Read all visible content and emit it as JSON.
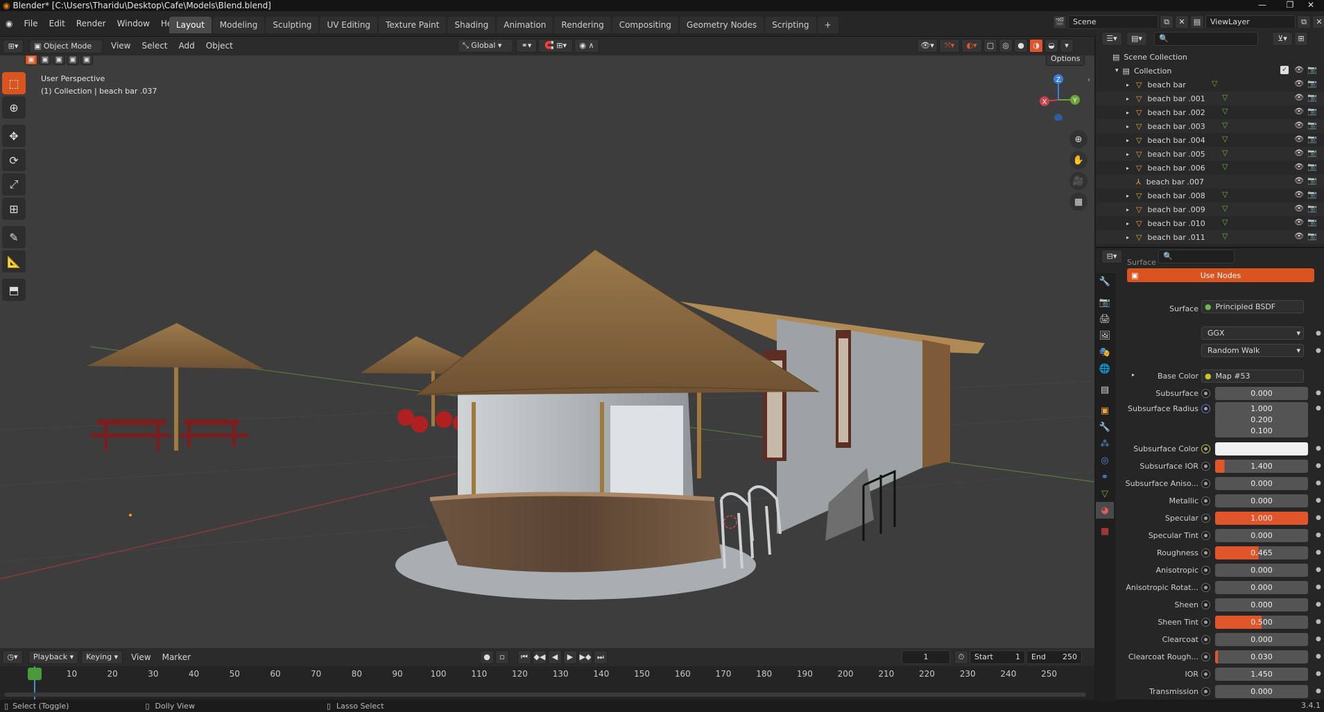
{
  "title_bar": {
    "title": "Blender* [C:\\Users\\Tharidu\\Desktop\\Cafe\\Models\\Blend.blend]"
  },
  "top_menu": [
    "File",
    "Edit",
    "Render",
    "Window",
    "Help"
  ],
  "workspace_tabs": [
    "Layout",
    "Modeling",
    "Sculpting",
    "UV Editing",
    "Texture Paint",
    "Shading",
    "Animation",
    "Rendering",
    "Compositing",
    "Geometry Nodes",
    "Scripting"
  ],
  "active_workspace": "Layout",
  "scene": {
    "scene_name": "Scene",
    "view_layer": "ViewLayer"
  },
  "viewport_header": {
    "mode": "Object Mode",
    "menus": [
      "View",
      "Select",
      "Add",
      "Object"
    ],
    "orientation": "Global",
    "options_label": "Options"
  },
  "viewport": {
    "info_line1": "User Perspective",
    "info_line2": "(1) Collection | beach bar .037"
  },
  "gizmo": {
    "z": "Z",
    "y": "Y",
    "x": "X"
  },
  "timeline": {
    "menus": [
      "Playback",
      "Keying",
      "View",
      "Marker"
    ],
    "current_frame": "1",
    "start_label": "Start",
    "start": "1",
    "end_label": "End",
    "end": "250",
    "ticks": [
      "1",
      "10",
      "20",
      "30",
      "40",
      "50",
      "60",
      "70",
      "80",
      "90",
      "100",
      "110",
      "120",
      "130",
      "140",
      "150",
      "160",
      "170",
      "180",
      "190",
      "200",
      "210",
      "220",
      "230",
      "240",
      "250"
    ]
  },
  "status_bar": {
    "left": "Select (Toggle)",
    "middle": "Dolly View",
    "right": "Lasso Select",
    "version": "3.4.1"
  },
  "outliner": {
    "root": "Scene Collection",
    "collection": "Collection",
    "items": [
      {
        "name": "beach bar",
        "type": "mesh"
      },
      {
        "name": "beach bar .001",
        "type": "mesh"
      },
      {
        "name": "beach bar .002",
        "type": "mesh"
      },
      {
        "name": "beach bar .003",
        "type": "mesh"
      },
      {
        "name": "beach bar .004",
        "type": "mesh"
      },
      {
        "name": "beach bar .005",
        "type": "mesh"
      },
      {
        "name": "beach bar .006",
        "type": "mesh"
      },
      {
        "name": "beach bar .007",
        "type": "empty"
      },
      {
        "name": "beach bar .008",
        "type": "mesh"
      },
      {
        "name": "beach bar .009",
        "type": "mesh"
      },
      {
        "name": "beach bar .010",
        "type": "mesh"
      },
      {
        "name": "beach bar .011",
        "type": "mesh"
      }
    ]
  },
  "properties": {
    "section": "Surface",
    "use_nodes": "Use Nodes",
    "surface_label": "Surface",
    "surface_value": "Principled BSDF",
    "distribution": "GGX",
    "subsurface_method": "Random Walk",
    "fields": [
      {
        "label": "Base Color",
        "value": "Map #53",
        "kind": "link"
      },
      {
        "label": "Subsurface",
        "value": "0.000",
        "kind": "num",
        "fill": 0
      },
      {
        "label": "Subsurface Radius",
        "value": "1.000",
        "kind": "vec"
      },
      {
        "label": "",
        "value": "0.200",
        "kind": "vec"
      },
      {
        "label": "",
        "value": "0.100",
        "kind": "vec"
      },
      {
        "label": "Subsurface Color",
        "value": "",
        "kind": "color"
      },
      {
        "label": "Subsurface IOR",
        "value": "1.400",
        "kind": "num",
        "fill": 0.1
      },
      {
        "label": "Subsurface Aniso...",
        "value": "0.000",
        "kind": "num",
        "fill": 0
      },
      {
        "label": "Metallic",
        "value": "0.000",
        "kind": "num",
        "fill": 0
      },
      {
        "label": "Specular",
        "value": "1.000",
        "kind": "num",
        "fill": 1
      },
      {
        "label": "Specular Tint",
        "value": "0.000",
        "kind": "num",
        "fill": 0
      },
      {
        "label": "Roughness",
        "value": "0.465",
        "kind": "num",
        "fill": 0.465
      },
      {
        "label": "Anisotropic",
        "value": "0.000",
        "kind": "num",
        "fill": 0
      },
      {
        "label": "Anisotropic Rotat...",
        "value": "0.000",
        "kind": "num",
        "fill": 0
      },
      {
        "label": "Sheen",
        "value": "0.000",
        "kind": "num",
        "fill": 0
      },
      {
        "label": "Sheen Tint",
        "value": "0.500",
        "kind": "num",
        "fill": 0.5
      },
      {
        "label": "Clearcoat",
        "value": "0.000",
        "kind": "num",
        "fill": 0
      },
      {
        "label": "Clearcoat Rough...",
        "value": "0.030",
        "kind": "num",
        "fill": 0.03
      },
      {
        "label": "IOR",
        "value": "1.450",
        "kind": "num",
        "fill": 0
      },
      {
        "label": "Transmission",
        "value": "0.000",
        "kind": "num",
        "fill": 0
      }
    ]
  },
  "colors": {
    "accent": "#d9541f",
    "slider_fill": "#e0562a",
    "mesh_icon": "#e8a347",
    "data_icon": "#69b53e"
  }
}
